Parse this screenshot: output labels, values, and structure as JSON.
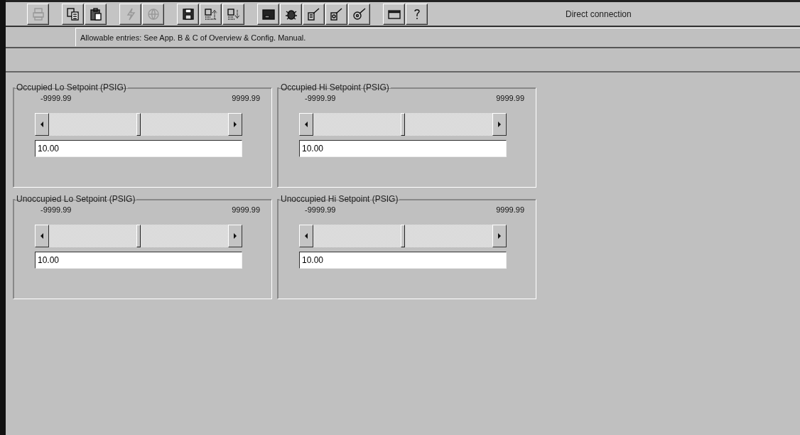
{
  "toolbar": {
    "groups": [
      [
        {
          "kind": "print",
          "disabled": true
        }
      ],
      [
        {
          "kind": "copy",
          "disabled": false
        },
        {
          "kind": "paste",
          "disabled": false
        }
      ],
      [
        {
          "kind": "flash",
          "disabled": true
        },
        {
          "kind": "globe",
          "disabled": true
        }
      ],
      [
        {
          "kind": "save",
          "disabled": false
        },
        {
          "kind": "upload",
          "disabled": false
        },
        {
          "kind": "download",
          "disabled": false
        }
      ],
      [
        {
          "kind": "device",
          "disabled": false
        },
        {
          "kind": "bug",
          "disabled": false
        },
        {
          "kind": "wand-doc",
          "disabled": false
        },
        {
          "kind": "wand-page",
          "disabled": false
        },
        {
          "kind": "wand-disc",
          "disabled": false
        }
      ],
      [
        {
          "kind": "window",
          "disabled": false
        },
        {
          "kind": "help",
          "disabled": false
        }
      ]
    ],
    "status": "Direct connection"
  },
  "message": "Allowable entries: See App. B & C of Overview & Config. Manual.",
  "setpoints": [
    {
      "title": "Occupied Lo Setpoint  (PSIG)",
      "min": "-9999.99",
      "max": "9999.99",
      "level": 0.5,
      "value": "10.00"
    },
    {
      "title": "Occupied Hi Setpoint  (PSIG)",
      "min": "-9999.99",
      "max": "9999.99",
      "level": 0.5,
      "value": "10.00"
    },
    {
      "title": "Unoccupied Lo Setpoint  (PSIG)",
      "min": "-9999.99",
      "max": "9999.99",
      "level": 0.5,
      "value": "10.00"
    },
    {
      "title": "Unoccupied Hi Setpoint  (PSIG)",
      "min": "-9999.99",
      "max": "9999.99",
      "level": 0.5,
      "value": "10.00"
    }
  ]
}
